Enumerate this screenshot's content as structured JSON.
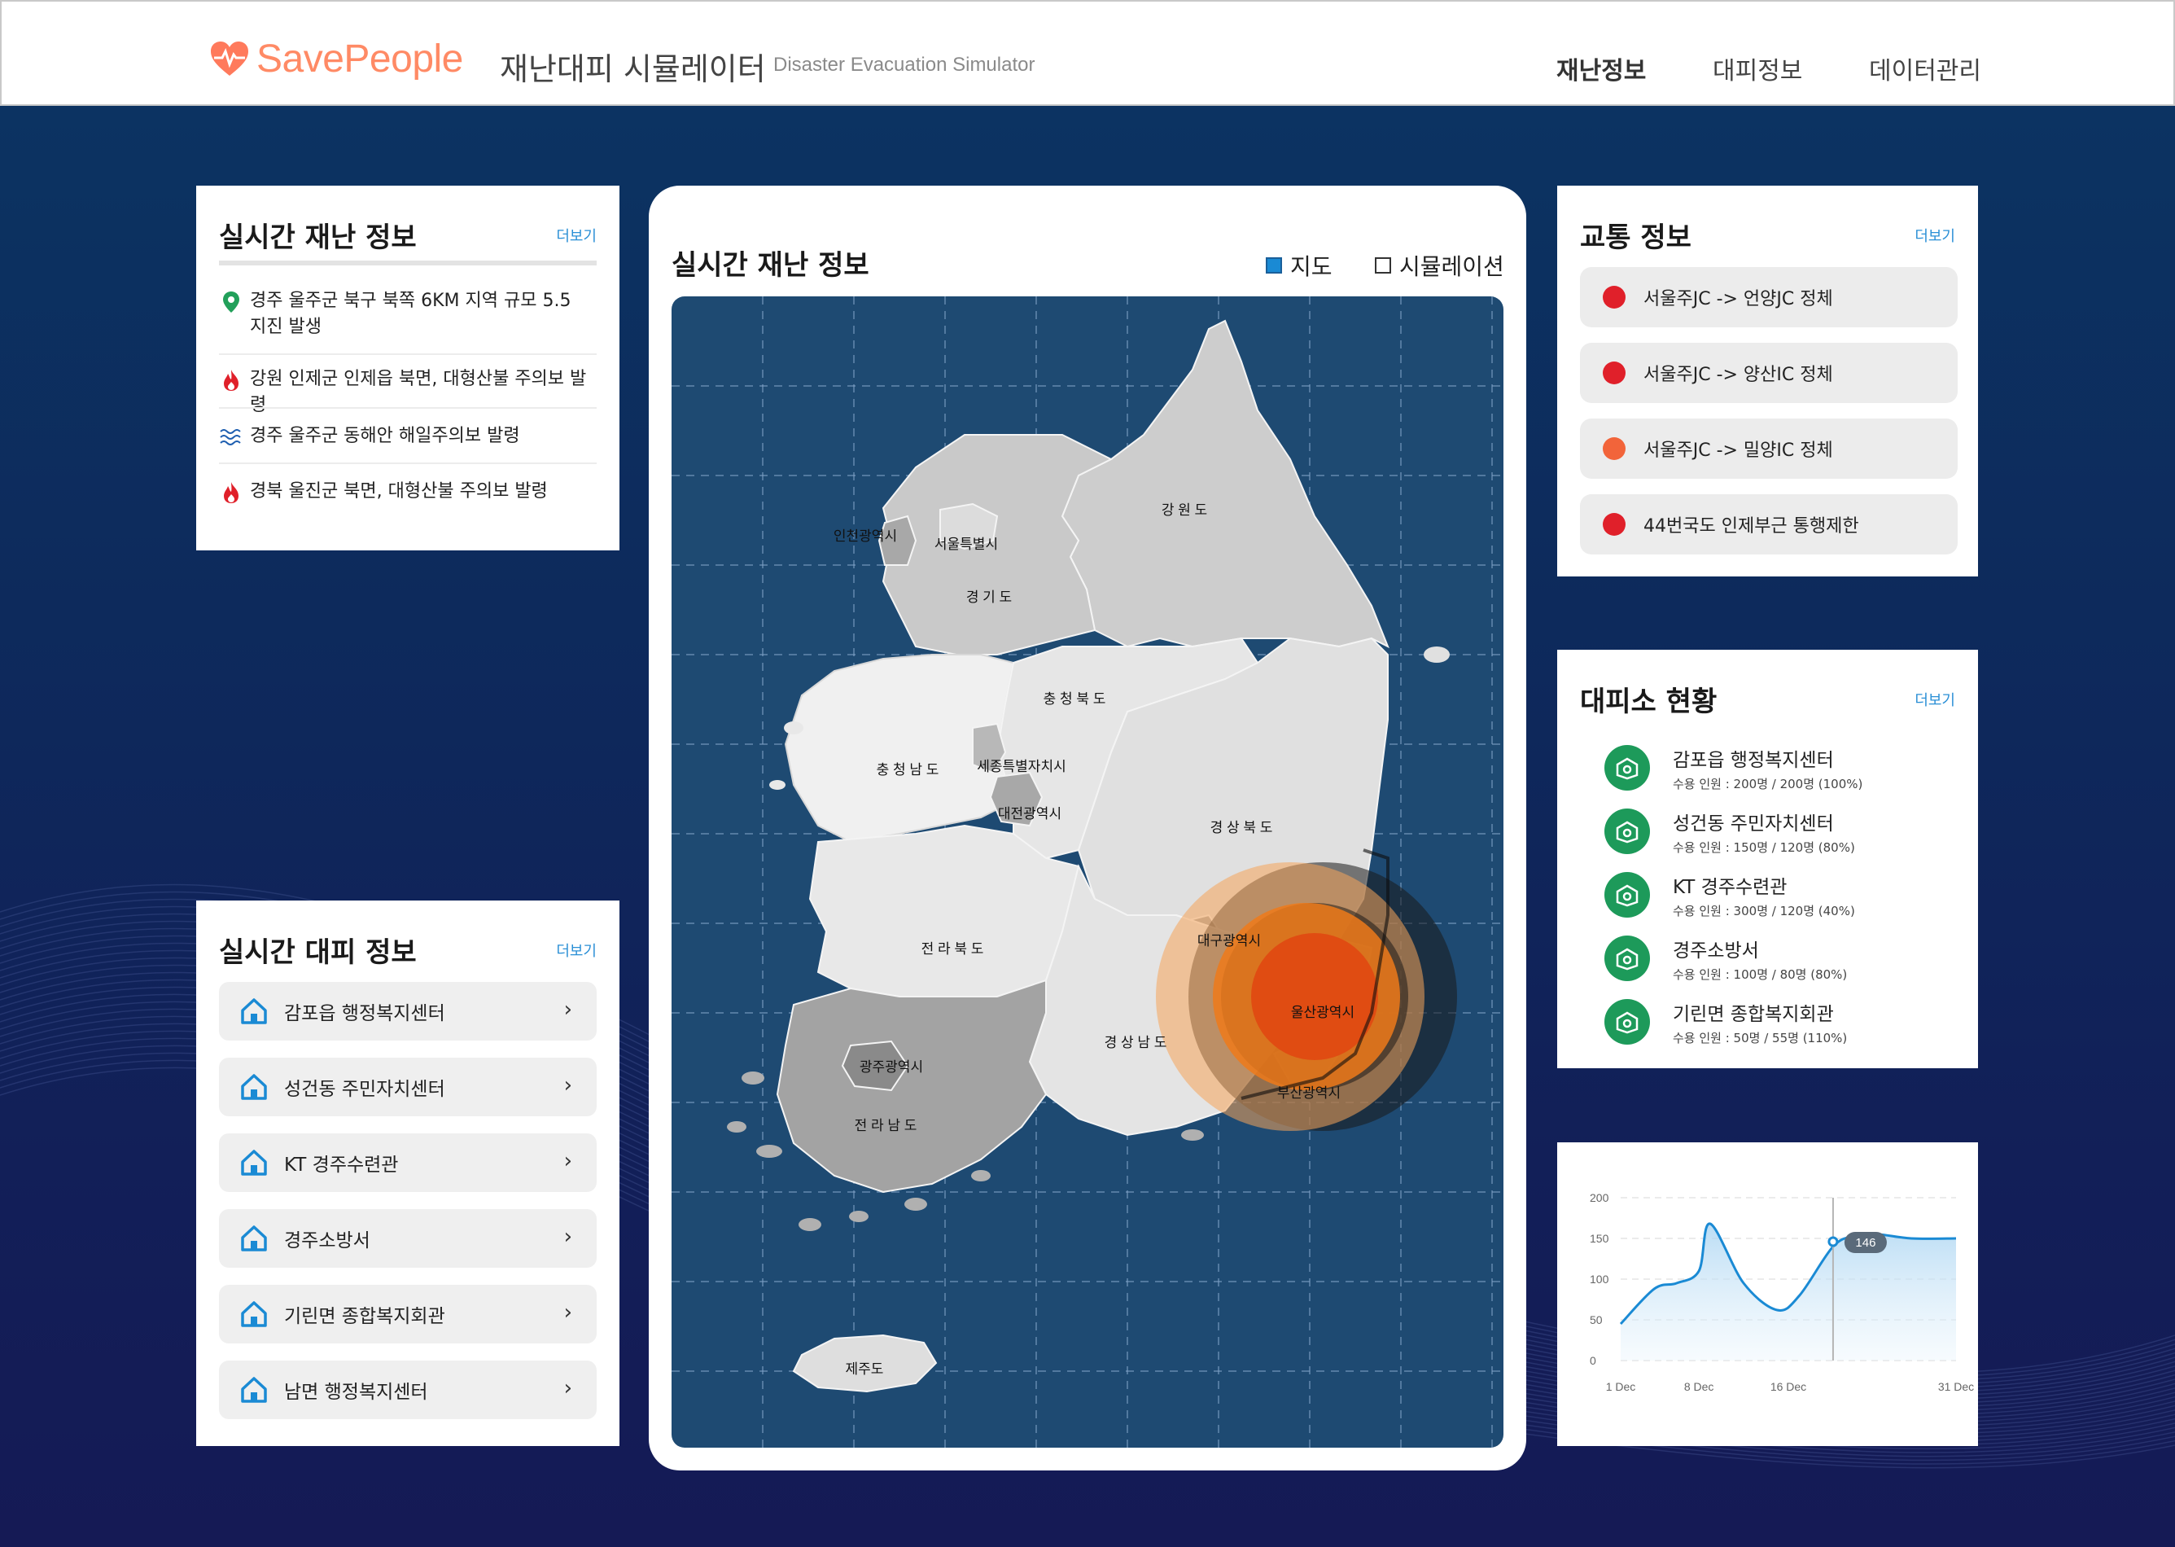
{
  "header": {
    "logo_text": "SavePeople",
    "title": "재난대피 시뮬레이터",
    "subtitle": "Disaster Evacuation Simulator",
    "nav": [
      {
        "label": "재난정보",
        "active": true
      },
      {
        "label": "대피정보",
        "active": false
      },
      {
        "label": "데이터관리",
        "active": false
      }
    ]
  },
  "disaster": {
    "title": "실시간 재난 정보",
    "more": "더보기",
    "items": [
      {
        "icon": "location-pin-icon",
        "text": "경주 울주군 북구 북쪽 6KM 지역 규모 5.5",
        "text2": "지진 발생"
      },
      {
        "icon": "fire-icon",
        "text": "강원 인제군 인제읍 북면, 대형산불 주의보 발령"
      },
      {
        "icon": "wave-icon",
        "text": "경주 울주군 동해안 해일주의보 발령"
      },
      {
        "icon": "fire-icon",
        "text": "경북 울진군 북면, 대형산불 주의보 발령"
      }
    ]
  },
  "evacuation": {
    "title": "실시간 대피 정보",
    "more": "더보기",
    "items": [
      "감포읍 행정복지센터",
      "성건동 주민자치센터",
      "KT 경주수련관",
      "경주소방서",
      "기린면 종합복지회관",
      "남면 행정복지센터"
    ],
    "chevron": "›"
  },
  "map": {
    "title": "실시간 재난 정보",
    "toggle_map": "지도",
    "toggle_sim": "시뮬레이션",
    "regions": {
      "incheon": "인천광역시",
      "seoul": "서울특별시",
      "gyeonggi": "경 기 도",
      "gangwon": "강 원 도",
      "chungbuk": "충 청 북 도",
      "chungnam": "충 청 남 도",
      "sejong": "세종특별자치시",
      "daejeon": "대전광역시",
      "gyeongbuk": "경 상 북 도",
      "jeonbuk": "전 라 북 도",
      "daegu": "대구광역시",
      "ulsan": "울산광역시",
      "gyeongnam": "경 상 남 도",
      "gwangju": "광주광역시",
      "busan": "부산광역시",
      "jeonnam": "전 라 남 도",
      "jeju": "제주도"
    }
  },
  "traffic": {
    "title": "교통 정보",
    "more": "더보기",
    "items": [
      {
        "text": "서울주JC -> 언양JC 정체",
        "color": "#e0202a"
      },
      {
        "text": "서울주JC -> 양산IC 정체",
        "color": "#e0202a"
      },
      {
        "text": "서울주JC -> 밀양IC 정체",
        "color": "#f2643a"
      },
      {
        "text": "44번국도 인제부근 통행제한",
        "color": "#e0202a"
      }
    ]
  },
  "shelters": {
    "title": "대피소 현황",
    "more": "더보기",
    "items": [
      {
        "name": "감포읍 행정복지센터",
        "cap": "수용 인원 : 200명 / 200명 (100%)"
      },
      {
        "name": "성건동 주민자치센터",
        "cap": "수용 인원 : 150명 / 120명 (80%)"
      },
      {
        "name": "KT 경주수련관",
        "cap": "수용 인원 : 300명 / 120명 (40%)"
      },
      {
        "name": "경주소방서",
        "cap": "수용 인원 : 100명 / 80명 (80%)"
      },
      {
        "name": "기린면 종합복지회관",
        "cap": "수용 인원 : 50명 / 55명 (110%)"
      }
    ]
  },
  "chart_data": {
    "type": "area",
    "x": [
      1,
      4,
      6,
      8,
      9,
      12,
      15,
      17,
      20,
      22,
      24,
      27,
      31
    ],
    "x_tick_labels": [
      "1 Dec",
      "8 Dec",
      "16 Dec",
      "31 Dec"
    ],
    "x_tick_values": [
      1,
      8,
      16,
      31
    ],
    "values": [
      45,
      88,
      95,
      110,
      168,
      95,
      62,
      80,
      140,
      153,
      155,
      150,
      150
    ],
    "ylim": [
      0,
      200
    ],
    "y_ticks": [
      0,
      50,
      100,
      150,
      200
    ],
    "tooltip": {
      "x": 20,
      "value": 146,
      "label": "146"
    },
    "line_color": "#1a8ad4",
    "grid": true
  }
}
